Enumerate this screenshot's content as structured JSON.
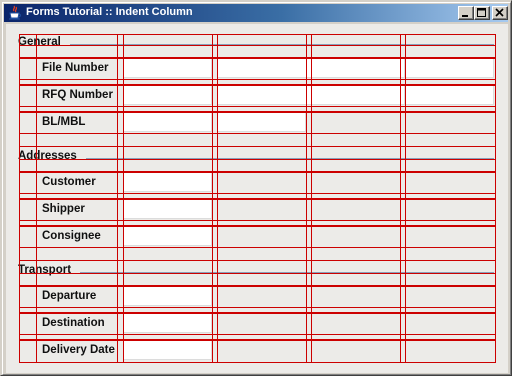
{
  "window": {
    "title": "Forms Tutorial :: Indent Column",
    "buttons": {
      "minimize": "minimize",
      "maximize": "maximize",
      "close": "close"
    }
  },
  "sections": {
    "general": {
      "title": "General",
      "fields": {
        "file_number": {
          "label": "File Number",
          "values": [
            "",
            "",
            ""
          ]
        },
        "rfq_number": {
          "label": "RFQ Number",
          "values": [
            "",
            "",
            ""
          ]
        },
        "bl_mbl": {
          "label": "BL/MBL",
          "values": [
            "",
            ""
          ]
        }
      }
    },
    "addresses": {
      "title": "Addresses",
      "fields": {
        "customer": {
          "label": "Customer",
          "value": ""
        },
        "shipper": {
          "label": "Shipper",
          "value": ""
        },
        "consignee": {
          "label": "Consignee",
          "value": ""
        }
      }
    },
    "transport": {
      "title": "Transport",
      "fields": {
        "departure": {
          "label": "Departure",
          "value": ""
        },
        "destination": {
          "label": "Destination",
          "value": ""
        },
        "delivery_date": {
          "label": "Delivery Date",
          "value": ""
        }
      }
    }
  },
  "colors": {
    "debug_grid": "#cc0000",
    "separator_line": "#8a9fb8",
    "titlebar_start": "#0a246a",
    "titlebar_end": "#a6caf0"
  }
}
